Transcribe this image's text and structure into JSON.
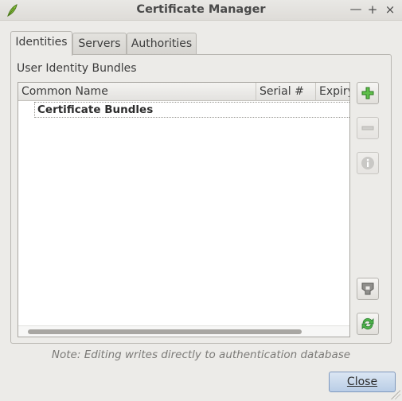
{
  "window": {
    "title": "Certificate Manager",
    "minimize_glyph": "—",
    "maximize_glyph": "+",
    "close_glyph": "×"
  },
  "tabs": [
    {
      "label": "Identities",
      "active": true
    },
    {
      "label": "Servers",
      "active": false
    },
    {
      "label": "Authorities",
      "active": false
    }
  ],
  "identities": {
    "group_label": "User Identity Bundles",
    "columns": [
      "Common Name",
      "Serial #",
      "Expiry"
    ],
    "rows": [
      {
        "label": "Certificate Bundles"
      }
    ]
  },
  "side_buttons": [
    {
      "name": "add-button",
      "icon": "plus-icon",
      "enabled": true
    },
    {
      "name": "remove-button",
      "icon": "minus-icon",
      "enabled": false
    },
    {
      "name": "info-button",
      "icon": "info-icon",
      "enabled": false
    },
    {
      "name": "group-by-button",
      "icon": "group-icon",
      "enabled": true
    },
    {
      "name": "refresh-button",
      "icon": "refresh-icon",
      "enabled": true
    }
  ],
  "note": "Note: Editing writes directly to authentication database",
  "close_button": {
    "label": "Close"
  },
  "colors": {
    "add_green": "#3a9a2c",
    "refresh_green": "#2f9a3c",
    "disabled_gray": "#b8b7b3",
    "close_button": "#c9d9ee"
  }
}
